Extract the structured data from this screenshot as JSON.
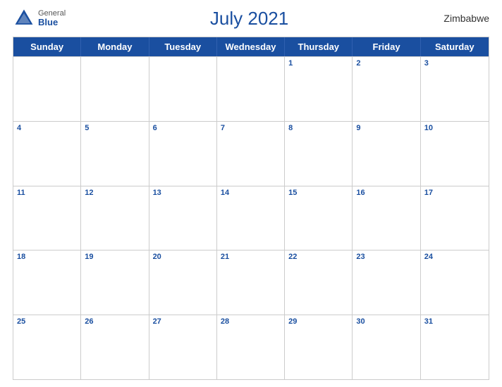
{
  "header": {
    "title": "July 2021",
    "country": "Zimbabwe",
    "logo": {
      "general": "General",
      "blue": "Blue"
    }
  },
  "calendar": {
    "dayHeaders": [
      "Sunday",
      "Monday",
      "Tuesday",
      "Wednesday",
      "Thursday",
      "Friday",
      "Saturday"
    ],
    "weeks": [
      [
        {
          "date": "",
          "empty": true
        },
        {
          "date": "",
          "empty": true
        },
        {
          "date": "",
          "empty": true
        },
        {
          "date": "",
          "empty": true
        },
        {
          "date": "1",
          "empty": false
        },
        {
          "date": "2",
          "empty": false
        },
        {
          "date": "3",
          "empty": false
        }
      ],
      [
        {
          "date": "4",
          "empty": false
        },
        {
          "date": "5",
          "empty": false
        },
        {
          "date": "6",
          "empty": false
        },
        {
          "date": "7",
          "empty": false
        },
        {
          "date": "8",
          "empty": false
        },
        {
          "date": "9",
          "empty": false
        },
        {
          "date": "10",
          "empty": false
        }
      ],
      [
        {
          "date": "11",
          "empty": false
        },
        {
          "date": "12",
          "empty": false
        },
        {
          "date": "13",
          "empty": false
        },
        {
          "date": "14",
          "empty": false
        },
        {
          "date": "15",
          "empty": false
        },
        {
          "date": "16",
          "empty": false
        },
        {
          "date": "17",
          "empty": false
        }
      ],
      [
        {
          "date": "18",
          "empty": false
        },
        {
          "date": "19",
          "empty": false
        },
        {
          "date": "20",
          "empty": false
        },
        {
          "date": "21",
          "empty": false
        },
        {
          "date": "22",
          "empty": false
        },
        {
          "date": "23",
          "empty": false
        },
        {
          "date": "24",
          "empty": false
        }
      ],
      [
        {
          "date": "25",
          "empty": false
        },
        {
          "date": "26",
          "empty": false
        },
        {
          "date": "27",
          "empty": false
        },
        {
          "date": "28",
          "empty": false
        },
        {
          "date": "29",
          "empty": false
        },
        {
          "date": "30",
          "empty": false
        },
        {
          "date": "31",
          "empty": false
        }
      ]
    ]
  }
}
